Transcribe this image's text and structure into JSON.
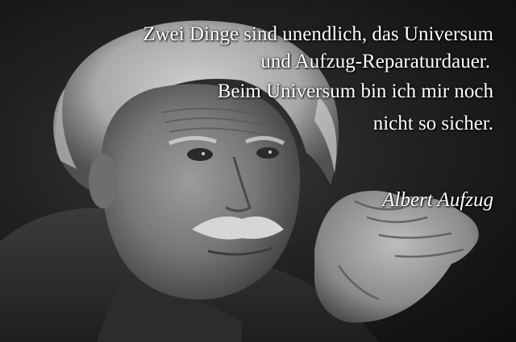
{
  "quote": {
    "lines": [
      "Zwei Dinge sind unendlich, das Universum",
      "und Aufzug-Reparaturdauer.",
      "Beim Universum bin ich mir noch",
      "nicht so sicher."
    ],
    "author": "Albert Aufzug"
  },
  "colors": {
    "text": "#ffffff",
    "background": "#1a1a1a"
  }
}
